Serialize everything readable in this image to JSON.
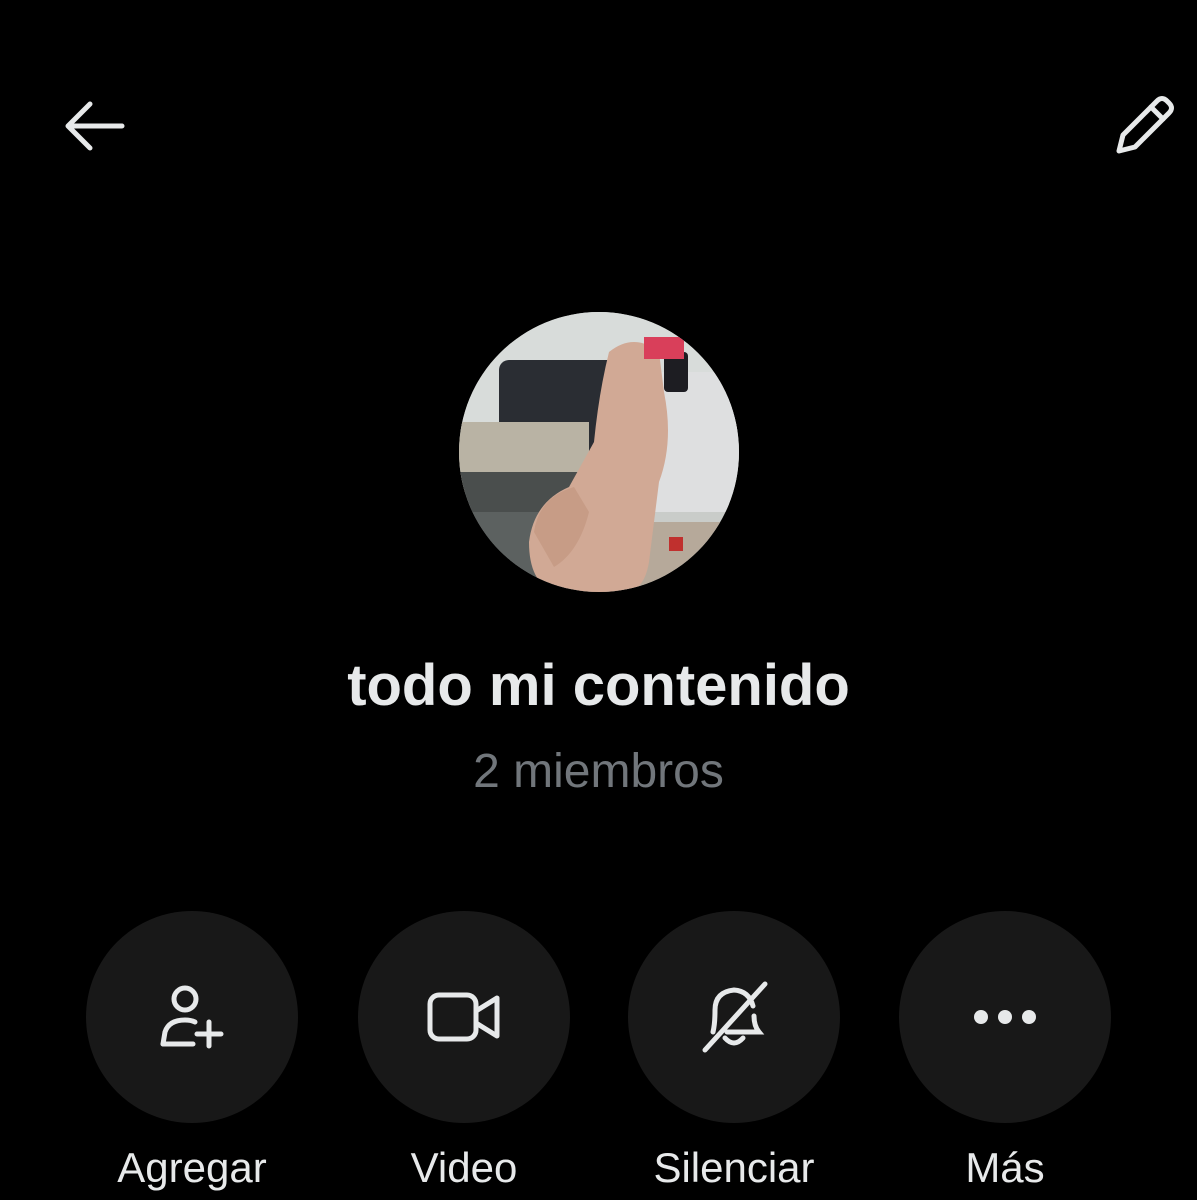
{
  "header": {
    "back_icon": "arrow-left-icon",
    "edit_icon": "pencil-icon"
  },
  "group": {
    "name": "todo mi contenido",
    "members": "2 miembros"
  },
  "actions": [
    {
      "label": "Agregar",
      "icon": "add-person-icon"
    },
    {
      "label": "Video",
      "icon": "video-camera-icon"
    },
    {
      "label": "Silenciar",
      "icon": "bell-slash-icon"
    },
    {
      "label": "Más",
      "icon": "more-horizontal-icon"
    }
  ],
  "colors": {
    "background": "#000000",
    "primary_text": "#e7e9ea",
    "secondary_text": "#71767b",
    "button_background": "#181818"
  }
}
